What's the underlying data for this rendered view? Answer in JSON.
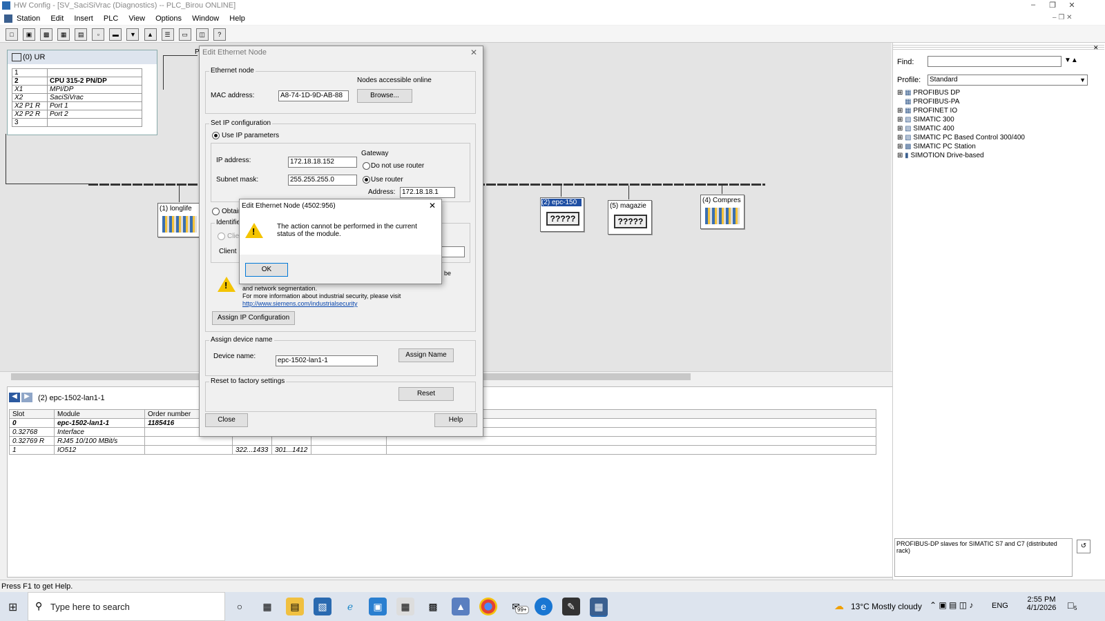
{
  "window": {
    "title": "HW Config - [SV_SaciSiVrac (Diagnostics) -- PLC_Birou  ONLINE]",
    "menu": [
      "Station",
      "Edit",
      "Insert",
      "PLC",
      "View",
      "Options",
      "Window",
      "Help"
    ]
  },
  "rack": {
    "title": "(0) UR",
    "rows": [
      {
        "slot": "1",
        "name": ""
      },
      {
        "slot": "2",
        "name": "CPU 315-2 PN/DP"
      },
      {
        "slot": "X1",
        "name": "MPI/DP"
      },
      {
        "slot": "X2",
        "name": "SaciSiVrac"
      },
      {
        "slot": "X2 P1 R",
        "name": "Port 1"
      },
      {
        "slot": "X2 P2 R",
        "name": "Port 2"
      },
      {
        "slot": "3",
        "name": ""
      }
    ]
  },
  "nodes": {
    "n1": "(1) longlife",
    "n2": "(2) epc-150",
    "n2q": "?????",
    "n5": "(5) magazie",
    "n5q": "?????",
    "n4": "(4) Compres",
    "pn_tag": "P"
  },
  "bottom": {
    "station": "(2)    epc-1502-lan1-1",
    "headers": [
      "Slot",
      "Module",
      "Order number"
    ],
    "rows": [
      {
        "slot": "0",
        "module": "epc-1502-lan1-1",
        "order": "1185416",
        "c4": "",
        "c5": ""
      },
      {
        "slot": "0.32768",
        "module": "Interface",
        "order": "",
        "c4": "",
        "c5": ""
      },
      {
        "slot": "0.32769 R",
        "module": "RJ45 10/100 MBit/s",
        "order": "",
        "c4": "",
        "c5": ""
      },
      {
        "slot": "1",
        "module": "IO512",
        "order": "",
        "c4": "322...1433",
        "c5": "301...1412"
      }
    ]
  },
  "catalog": {
    "find_label": "Find:",
    "profile_label": "Profile:",
    "profile_value": "Standard",
    "items": [
      "PROFIBUS DP",
      "PROFIBUS-PA",
      "PROFINET IO",
      "SIMATIC 300",
      "SIMATIC 400",
      "SIMATIC PC Based Control 300/400",
      "SIMATIC PC Station",
      "SIMOTION Drive-based"
    ],
    "description": "PROFIBUS-DP slaves for SIMATIC S7 and C7 (distributed rack)"
  },
  "status_text": "Press F1 to get Help.",
  "dialog": {
    "title": "Edit Ethernet Node",
    "ethernet_node": "Ethernet node",
    "nodes_online": "Nodes accessible online",
    "mac_label": "MAC address:",
    "mac_value": "A8-74-1D-9D-AB-88",
    "browse": "Browse...",
    "set_ip": "Set IP configuration",
    "use_ip": "Use IP parameters",
    "ip_label": "IP address:",
    "ip_value": "172.18.18.152",
    "gateway": "Gateway",
    "no_router": "Do not use router",
    "use_router": "Use router",
    "subnet_label": "Subnet mask:",
    "subnet_value": "255.255.255.0",
    "address_label": "Address:",
    "address_value": "172.18.18.1",
    "obtain": "Obtain",
    "identified": "Identified",
    "client": "Clien",
    "client_id": "Client ID",
    "security_be": "be",
    "security_text1": "and network segmentation.",
    "security_text2": "For more information about industrial security, please visit",
    "security_link": "http://www.siemens.com/industrialsecurity",
    "assign_ip": "Assign IP Configuration",
    "assign_name_group": "Assign device name",
    "device_label": "Device name:",
    "device_value": "epc-1502-lan1-1",
    "assign_name": "Assign Name",
    "reset_group": "Reset to factory settings",
    "reset": "Reset",
    "close": "Close",
    "help": "Help"
  },
  "message": {
    "title": "Edit Ethernet Node  (4502:956)",
    "text": "The action cannot be performed in the current status of the module.",
    "ok": "OK"
  },
  "taskbar": {
    "search": "Type here to search",
    "badge": "99+",
    "weather": "13°C  Mostly cloudy",
    "lang": "ENG",
    "time": "2:55 PM",
    "date": "4/1/2026",
    "notif": "5"
  }
}
